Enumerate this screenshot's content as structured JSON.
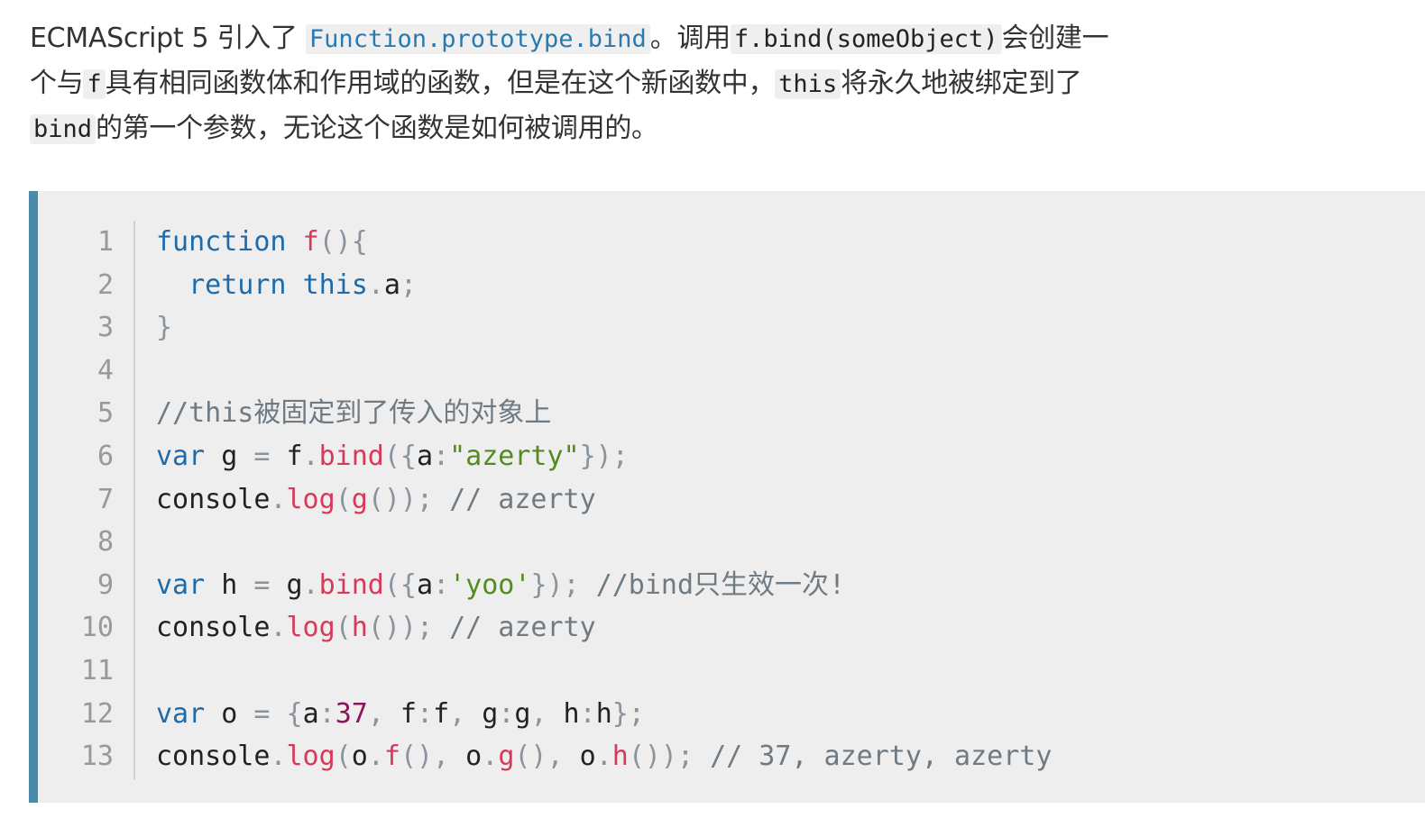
{
  "intro": {
    "line1": [
      {
        "t": "text",
        "v": "ECMAScript 5 引入了 "
      },
      {
        "t": "codelink",
        "v": "Function.prototype.bind"
      },
      {
        "t": "text",
        "v": "。调用"
      },
      {
        "t": "code",
        "v": "f.bind(someObject)"
      },
      {
        "t": "text",
        "v": "会创建一"
      }
    ],
    "line2": [
      {
        "t": "text",
        "v": "个与"
      },
      {
        "t": "code",
        "v": "f"
      },
      {
        "t": "text",
        "v": "具有相同函数体和作用域的函数，但是在这个新函数中，"
      },
      {
        "t": "code",
        "v": "this"
      },
      {
        "t": "text",
        "v": "将永久地被绑定到了"
      }
    ],
    "line3": [
      {
        "t": "code",
        "v": "bind"
      },
      {
        "t": "text",
        "v": "的第一个参数，无论这个函数是如何被调用的。"
      }
    ]
  },
  "code": {
    "line_numbers": [
      "1",
      "2",
      "3",
      "4",
      "5",
      "6",
      "7",
      "8",
      "9",
      "10",
      "11",
      "12",
      "13"
    ],
    "lines": [
      [
        [
          "kw",
          "function"
        ],
        [
          "pl",
          " "
        ],
        [
          "fn",
          "f"
        ],
        [
          "pn",
          "(){"
        ]
      ],
      [
        [
          "pl",
          "  "
        ],
        [
          "kw",
          "return"
        ],
        [
          "pl",
          " "
        ],
        [
          "kw",
          "this"
        ],
        [
          "pn",
          "."
        ],
        [
          "pl",
          "a"
        ],
        [
          "pn",
          ";"
        ]
      ],
      [
        [
          "pn",
          "}"
        ]
      ],
      [],
      [
        [
          "com",
          "//this被固定到了传入的对象上"
        ]
      ],
      [
        [
          "kw",
          "var"
        ],
        [
          "pl",
          " g "
        ],
        [
          "pn",
          "="
        ],
        [
          "pl",
          " f"
        ],
        [
          "pn",
          "."
        ],
        [
          "fn",
          "bind"
        ],
        [
          "pn",
          "({"
        ],
        [
          "pl",
          "a"
        ],
        [
          "pn",
          ":"
        ],
        [
          "str",
          "\"azerty\""
        ],
        [
          "pn",
          "});"
        ]
      ],
      [
        [
          "pl",
          "console"
        ],
        [
          "pn",
          "."
        ],
        [
          "fn",
          "log"
        ],
        [
          "pn",
          "("
        ],
        [
          "fn",
          "g"
        ],
        [
          "pn",
          "());"
        ],
        [
          "pl",
          " "
        ],
        [
          "com",
          "// azerty"
        ]
      ],
      [],
      [
        [
          "kw",
          "var"
        ],
        [
          "pl",
          " h "
        ],
        [
          "pn",
          "="
        ],
        [
          "pl",
          " g"
        ],
        [
          "pn",
          "."
        ],
        [
          "fn",
          "bind"
        ],
        [
          "pn",
          "({"
        ],
        [
          "pl",
          "a"
        ],
        [
          "pn",
          ":"
        ],
        [
          "str",
          "'yoo'"
        ],
        [
          "pn",
          "});"
        ],
        [
          "pl",
          " "
        ],
        [
          "com",
          "//bind只生效一次!"
        ]
      ],
      [
        [
          "pl",
          "console"
        ],
        [
          "pn",
          "."
        ],
        [
          "fn",
          "log"
        ],
        [
          "pn",
          "("
        ],
        [
          "fn",
          "h"
        ],
        [
          "pn",
          "());"
        ],
        [
          "pl",
          " "
        ],
        [
          "com",
          "// azerty"
        ]
      ],
      [],
      [
        [
          "kw",
          "var"
        ],
        [
          "pl",
          " o "
        ],
        [
          "pn",
          "="
        ],
        [
          "pl",
          " "
        ],
        [
          "pn",
          "{"
        ],
        [
          "pl",
          "a"
        ],
        [
          "pn",
          ":"
        ],
        [
          "num",
          "37"
        ],
        [
          "pn",
          ","
        ],
        [
          "pl",
          " f"
        ],
        [
          "pn",
          ":"
        ],
        [
          "pl",
          "f"
        ],
        [
          "pn",
          ","
        ],
        [
          "pl",
          " g"
        ],
        [
          "pn",
          ":"
        ],
        [
          "pl",
          "g"
        ],
        [
          "pn",
          ","
        ],
        [
          "pl",
          " h"
        ],
        [
          "pn",
          ":"
        ],
        [
          "pl",
          "h"
        ],
        [
          "pn",
          "};"
        ]
      ],
      [
        [
          "pl",
          "console"
        ],
        [
          "pn",
          "."
        ],
        [
          "fn",
          "log"
        ],
        [
          "pn",
          "("
        ],
        [
          "pl",
          "o"
        ],
        [
          "pn",
          "."
        ],
        [
          "fn",
          "f"
        ],
        [
          "pn",
          "(),"
        ],
        [
          "pl",
          " o"
        ],
        [
          "pn",
          "."
        ],
        [
          "fn",
          "g"
        ],
        [
          "pn",
          "(),"
        ],
        [
          "pl",
          " o"
        ],
        [
          "pn",
          "."
        ],
        [
          "fn",
          "h"
        ],
        [
          "pn",
          "());"
        ],
        [
          "pl",
          " "
        ],
        [
          "com",
          "// 37, azerty, azerty"
        ]
      ]
    ]
  },
  "colors": {
    "accent_bar": "#4a8aaa",
    "keyword": "#1f6aa8",
    "function": "#d63a5a",
    "string": "#558a1f",
    "number": "#8a1559",
    "comment": "#6f7a83",
    "code_background": "#eeeeee"
  }
}
